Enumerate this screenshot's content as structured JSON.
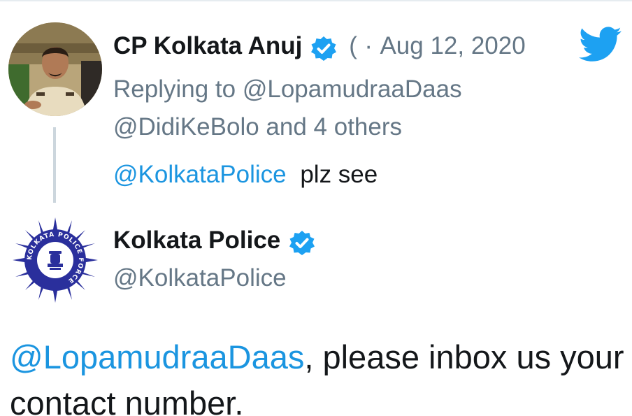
{
  "tweet1": {
    "author_name": "CP Kolkata Anuj",
    "handle_truncated": "(",
    "separator": "·",
    "date": "Aug 12, 2020",
    "replying_to_prefix": "Replying to ",
    "replying_to_handle": "@LopamudraaDaas",
    "replying_to_line2_handle": "@DidiKeBolo",
    "replying_to_and": " and ",
    "replying_to_others": "4 others",
    "text_mention": "@KolkataPolice",
    "text_rest": "plz see"
  },
  "tweet2": {
    "author_name": "Kolkata Police",
    "handle": "@KolkataPolice",
    "text_mention": "@LopamudraaDaas",
    "text_rest": ", please inbox us your contact number.",
    "logo_text": "KOLKATA POLICE FORCE"
  },
  "colors": {
    "link": "#1b95e0",
    "muted": "#657786",
    "verified": "#1da1f2",
    "twitter_blue": "#1da1f2",
    "logo_blue": "#2a2f9c"
  },
  "icons": {
    "verified": "verified-badge-icon",
    "twitter": "twitter-bird-icon"
  }
}
